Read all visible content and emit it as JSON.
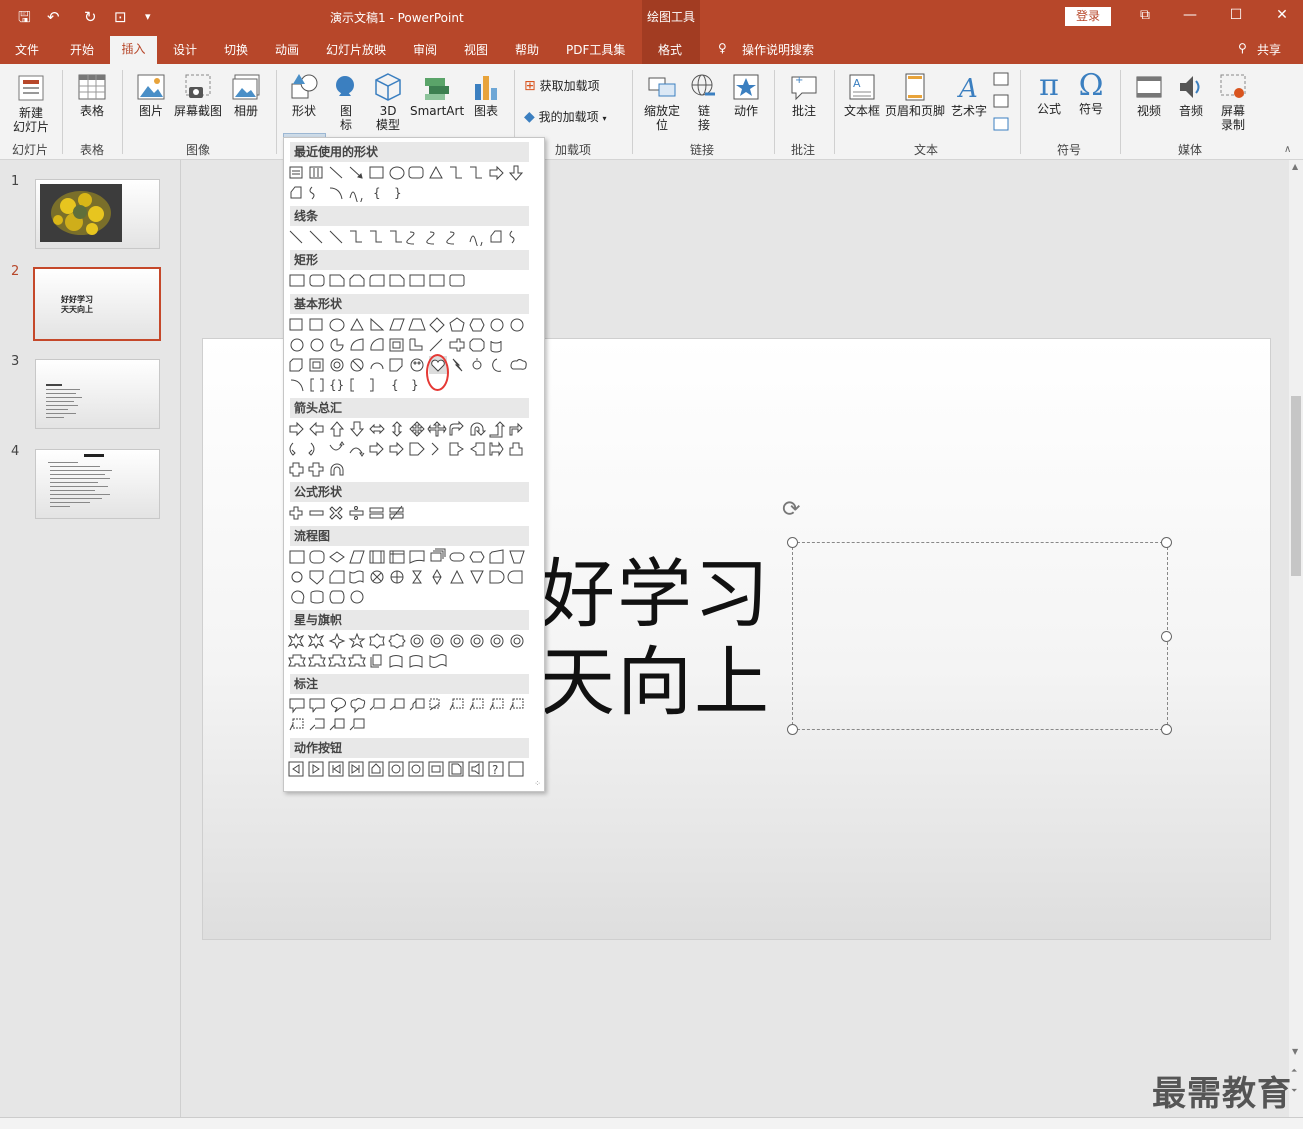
{
  "app": {
    "doc_title": "演示文稿1  -  PowerPoint",
    "contextual_tools": "绘图工具",
    "login": "登录"
  },
  "qat": {
    "save": "🖫",
    "undo": "↶",
    "redo": "↻",
    "more": "▾"
  },
  "window": {
    "restore": "⧉",
    "minimize": "—",
    "maximize": "☐",
    "close": "✕"
  },
  "tabs": [
    "文件",
    "开始",
    "插入",
    "设计",
    "切换",
    "动画",
    "幻灯片放映",
    "审阅",
    "视图",
    "帮助",
    "PDF工具集",
    "格式"
  ],
  "tell_me": "操作说明搜索",
  "share": "共享",
  "ribbon": {
    "new_slide": "新建\n幻灯片",
    "table": "表格",
    "picture": "图片",
    "screenshot": "屏幕截图",
    "album": "相册",
    "shapes": "形状",
    "icons": "图\n标",
    "model3d": "3D\n模型",
    "smartart": "SmartArt",
    "chart": "图表",
    "get_addins": "获取加载项",
    "my_addins": "我的加载项",
    "zoom": "缩放定\n位",
    "link": "链\n接",
    "action": "动作",
    "comment": "批注",
    "textbox": "文本框",
    "header_footer": "页眉和页脚",
    "wordart": "艺术字",
    "equation": "公式",
    "symbol": "符号",
    "video": "视频",
    "audio": "音频",
    "screen_record": "屏幕\n录制",
    "groups": [
      "幻灯片",
      "表格",
      "图像",
      "加载项",
      "链接",
      "批注",
      "文本",
      "符号",
      "媒体"
    ]
  },
  "slides": [
    {
      "num": "1"
    },
    {
      "num": "2",
      "text": "好好学习\n天天向上"
    },
    {
      "num": "3"
    },
    {
      "num": "4"
    }
  ],
  "slide_main": {
    "line1": "好学习",
    "line2": "天向上"
  },
  "shape_categories": [
    "最近使用的形状",
    "线条",
    "矩形",
    "基本形状",
    "箭头总汇",
    "公式形状",
    "流程图",
    "星与旗帜",
    "标注",
    "动作按钮"
  ],
  "watermark": "最需教育",
  "colors": {
    "accent": "#b7472a",
    "selected_shape": "#e53935"
  }
}
